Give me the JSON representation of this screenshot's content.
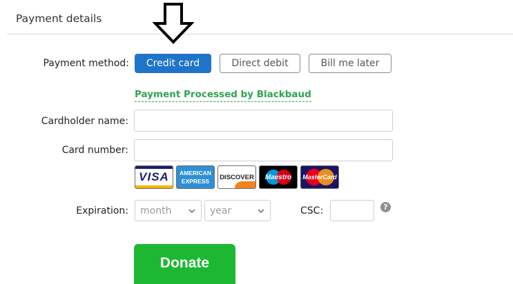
{
  "section": {
    "title": "Payment details"
  },
  "payment_method": {
    "label": "Payment method:",
    "options": [
      {
        "label": "Credit card",
        "selected": true
      },
      {
        "label": "Direct debit",
        "selected": false
      },
      {
        "label": "Bill me later",
        "selected": false
      }
    ]
  },
  "processed_by": "Payment Processed by Blackbaud",
  "cardholder": {
    "label": "Cardholder name:",
    "value": ""
  },
  "card_number": {
    "label": "Card number:",
    "value": ""
  },
  "card_logos": {
    "visa": "VISA",
    "amex_line1": "AMERICAN",
    "amex_line2": "EXPRESS",
    "discover": "DISCOVER",
    "maestro": "Maestro",
    "mastercard": "MasterCard"
  },
  "expiration": {
    "label": "Expiration:",
    "month_value": "month",
    "year_value": "year"
  },
  "csc": {
    "label": "CSC:",
    "value": "",
    "help_glyph": "?"
  },
  "donate_label": "Donate",
  "colors": {
    "accent": "#1f74c9",
    "processed": "#2ea44f",
    "donate": "#1cb832"
  }
}
